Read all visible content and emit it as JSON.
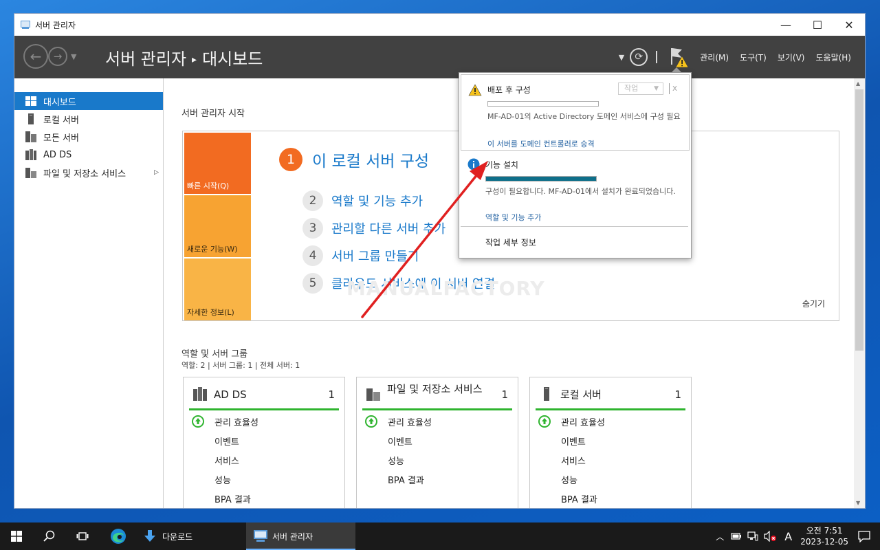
{
  "window": {
    "title": "서버 관리자",
    "minimize": "—",
    "maximize": "☐",
    "close": "✕"
  },
  "header": {
    "breadcrumb_root": "서버 관리자",
    "breadcrumb_sep": "▸",
    "breadcrumb_current": "대시보드",
    "menus": [
      "관리(M)",
      "도구(T)",
      "보기(V)",
      "도움말(H)"
    ]
  },
  "sidebar": {
    "items": [
      {
        "label": "대시보드",
        "icon": "dashboard-icon",
        "active": true
      },
      {
        "label": "로컬 서버",
        "icon": "server-icon"
      },
      {
        "label": "모든 서버",
        "icon": "servers-icon"
      },
      {
        "label": "AD DS",
        "icon": "ad-ds-icon"
      },
      {
        "label": "파일 및 저장소 서비스",
        "icon": "storage-icon",
        "expand": "▷"
      }
    ]
  },
  "main": {
    "welcome_title": "서버 관리자 시작",
    "tiles": [
      "빠른 시작(Q)",
      "새로운 기능(W)",
      "자세한 정보(L)"
    ],
    "steps": [
      {
        "num": "1",
        "label": "이 로컬 서버 구성"
      },
      {
        "num": "2",
        "label": "역할 및 기능 추가"
      },
      {
        "num": "3",
        "label": "관리할 다른 서버 추가"
      },
      {
        "num": "4",
        "label": "서버 그룹 만들기"
      },
      {
        "num": "5",
        "label": "클라우드 서비스에 이 서버 연결"
      }
    ],
    "watermark": "MANUALFACTORY",
    "hide": "숨기기",
    "roles_title": "역할 및 서버 그룹",
    "roles_summary": "역할: 2   |   서버 그룹: 1   |   전체 서버: 1",
    "cards": [
      {
        "title": "AD DS",
        "count": "1",
        "rows": [
          "관리 효율성",
          "이벤트",
          "서비스",
          "성능",
          "BPA 결과"
        ]
      },
      {
        "title": "파일 및 저장소 서비스",
        "count": "1",
        "rows": [
          "관리 효율성",
          "이벤트",
          "서비스",
          "성능",
          "BPA 결과"
        ]
      },
      {
        "title": "로컬 서버",
        "count": "1",
        "rows": [
          "관리 효율성",
          "이벤트",
          "서비스",
          "성능",
          "BPA 결과"
        ]
      }
    ]
  },
  "popup": {
    "n1": {
      "title": "배포 후 구성",
      "task": "작업",
      "close": "x",
      "progress": 0,
      "desc": "MF-AD-01의 Active Directory 도메인 서비스에 구성 필요",
      "link": "이 서버를 도메인 컨트롤러로 승격"
    },
    "n2": {
      "title": "기능 설치",
      "progress": 1,
      "desc": "구성이 필요합니다. MF-AD-01에서 설치가 완료되었습니다.",
      "link": "역할 및 기능 추가"
    },
    "task_detail": "작업 세부 정보"
  },
  "taskbar": {
    "downloads": "다운로드",
    "server_manager": "서버 관리자",
    "ime": "A",
    "time": "오전 7:51",
    "date": "2023-12-05"
  },
  "colors": {
    "accent": "#1979ca",
    "orange": "#f26b21",
    "green": "#2fb42f",
    "header": "#414141"
  }
}
